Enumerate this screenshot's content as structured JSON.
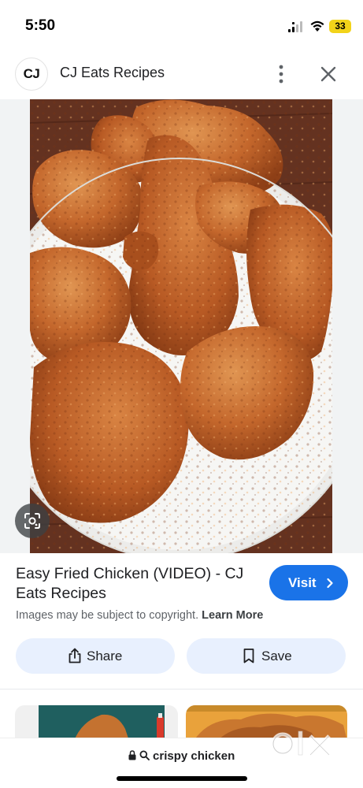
{
  "status_bar": {
    "time": "5:50",
    "battery_level": "33",
    "icons": [
      "signal-icon",
      "wifi-icon",
      "battery-icon"
    ],
    "battery_color": "#f2d31a"
  },
  "header": {
    "avatar_text": "CJ",
    "source_name": "CJ Eats Recipes",
    "icons": [
      "more-icon",
      "close-icon"
    ]
  },
  "image": {
    "lens_icon": "lens-icon"
  },
  "result": {
    "title": "Easy Fried Chicken (VIDEO) - CJ Eats Recipes",
    "visit_label": "Visit",
    "copyright_text": "Images may be subject to copyright.",
    "learn_more": "Learn More",
    "accent_color": "#1a73e8"
  },
  "actions": {
    "share_label": "Share",
    "save_label": "Save",
    "button_color": "#e8f0fe"
  },
  "browser": {
    "url_text": "crispy chicken",
    "icons": [
      "lock-icon",
      "search-icon"
    ]
  },
  "watermark": {
    "text": "olx"
  }
}
